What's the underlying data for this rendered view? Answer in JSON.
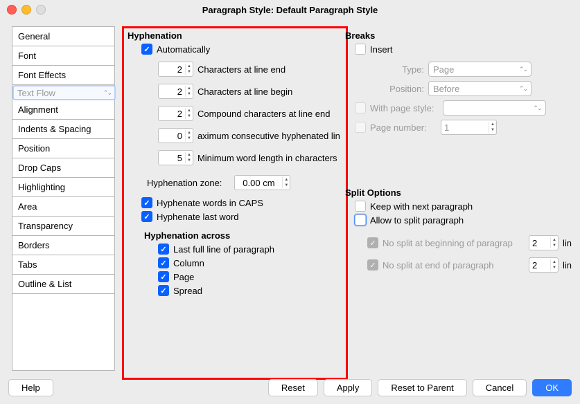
{
  "title": "Paragraph Style: Default Paragraph Style",
  "tabs": [
    "General",
    "Font",
    "Font Effects",
    "Text Flow",
    "Alignment",
    "Indents & Spacing",
    "Position",
    "Drop Caps",
    "Highlighting",
    "Area",
    "Transparency",
    "Borders",
    "Tabs",
    "Outline & List"
  ],
  "hyph": {
    "title": "Hyphenation",
    "auto": "Automatically",
    "chars_end": "2",
    "chars_end_lbl": "Characters at line end",
    "chars_begin": "2",
    "chars_begin_lbl": "Characters at line begin",
    "compound": "2",
    "compound_lbl": "Compound characters at line end",
    "max_consec": "0",
    "max_consec_lbl": "aximum consecutive hyphenated lin",
    "min_word": "5",
    "min_word_lbl": "Minimum word length in characters",
    "zone_lbl": "Hyphenation zone:",
    "zone": "0.00 cm",
    "caps": "Hyphenate words in CAPS",
    "last_word": "Hyphenate last word",
    "across_title": "Hyphenation across",
    "across": {
      "last_line": "Last full line of paragraph",
      "column": "Column",
      "page": "Page",
      "spread": "Spread"
    }
  },
  "breaks": {
    "title": "Breaks",
    "insert": "Insert",
    "type_lbl": "Type:",
    "type_val": "Page",
    "pos_lbl": "Position:",
    "pos_val": "Before",
    "with_style": "With page style:",
    "page_num_lbl": "Page number:",
    "page_num": "1"
  },
  "split": {
    "title": "Split Options",
    "keep_next": "Keep with next paragraph",
    "allow_split": "Allow to split paragraph",
    "no_split_begin": "No split at beginning of paragrap",
    "no_split_end": "No split at end of paragraph",
    "begin_val": "2",
    "end_val": "2",
    "lines_lbl": "lin"
  },
  "buttons": {
    "help": "Help",
    "reset": "Reset",
    "apply": "Apply",
    "reset_parent": "Reset to Parent",
    "cancel": "Cancel",
    "ok": "OK"
  }
}
